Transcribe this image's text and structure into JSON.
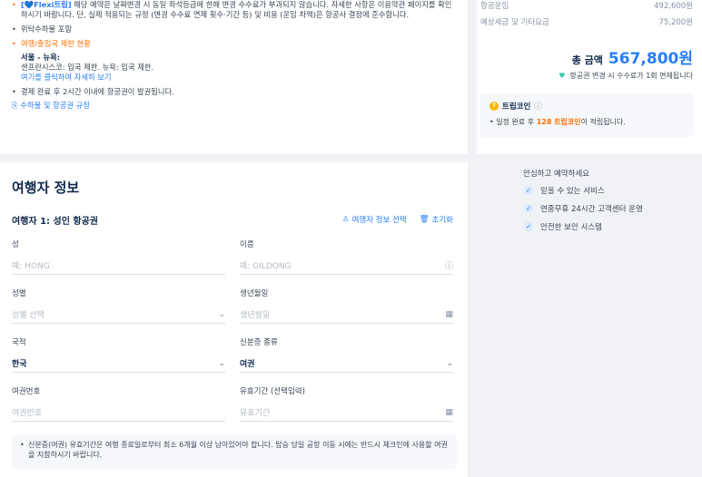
{
  "notes": {
    "flexi_tag": "[💙Flexi트립]",
    "flexi_text": " 해당 예약은 날짜변경 시 동일 좌석등급에 한해 변경 수수료가 부과되지 않습니다. 자세한 사항은 이용약관 페이지를 확인하시기 바랍니다. 단, 실제 적용되는 규정 (변경 수수료 면제 횟수·기간 등) 및 비용 (운임 차액)은 항공사 결정에 준수합니다.",
    "consignment": "위탁수하물 포함",
    "restriction_title": "여행/출입국 제한 현황",
    "restriction_route": "서울 - 뉴욕:",
    "restriction_detail": "샌프란시스코: 입국 제한. 뉴욕: 입국 제한.",
    "restriction_link": "여기를 클릭하여 자세히 보기",
    "ticketing": "결제 완료 후 2시간 이내에 항공권이 발권됩니다.",
    "baggage_link": "수하물 및 항공권 규정"
  },
  "fare": {
    "items": [
      {
        "label": "항공운임",
        "amount": "492,600원"
      },
      {
        "label": "예상세금 및 기타요금",
        "amount": "75,200원"
      }
    ],
    "total_label": "총 금액",
    "total_amount": "567,800원",
    "waiver": "항공권 변경 시 수수료가 1회 면제됩니다",
    "coin_title": "트립코인",
    "coin_desc_pre": "일정 완료 후 ",
    "coin_desc_hl": "128 트립코인",
    "coin_desc_post": "이 적립됩니다."
  },
  "traveler": {
    "section_title": "여행자 정보",
    "heading": "여행자 1: 성인 항공권",
    "select_action": "여행자 정보 선택",
    "reset_action": "초기화",
    "fields": {
      "surname": {
        "label": "성",
        "placeholder": "예: HONG"
      },
      "given_name": {
        "label": "이름",
        "placeholder": "예: GILDONG"
      },
      "gender": {
        "label": "성별",
        "placeholder": "성별 선택"
      },
      "birthdate": {
        "label": "생년월일",
        "placeholder": "생년월일"
      },
      "nationality": {
        "label": "국적",
        "value": "한국"
      },
      "id_type": {
        "label": "신분증 종류",
        "value": "여권"
      },
      "passport_no": {
        "label": "여권번호",
        "placeholder": "여권번호"
      },
      "expiry": {
        "label": "유효기간 (선택입력)",
        "placeholder": "유효기간"
      }
    },
    "disclaimer": "신분증(여권) 유효기간은 여행 종료일로부터 최소 6개월 이상 남아있어야 합니다. 탑승 당일 공항 이동 시에는 반드시 체크인에 사용할 여권을 지참하시기 바랍니다."
  },
  "assurance": {
    "title": "안심하고 예약하세요",
    "items": [
      "믿을 수 있는 서비스",
      "연중무휴 24시간 고객센터 운영",
      "안전한 보안 시스템"
    ]
  }
}
